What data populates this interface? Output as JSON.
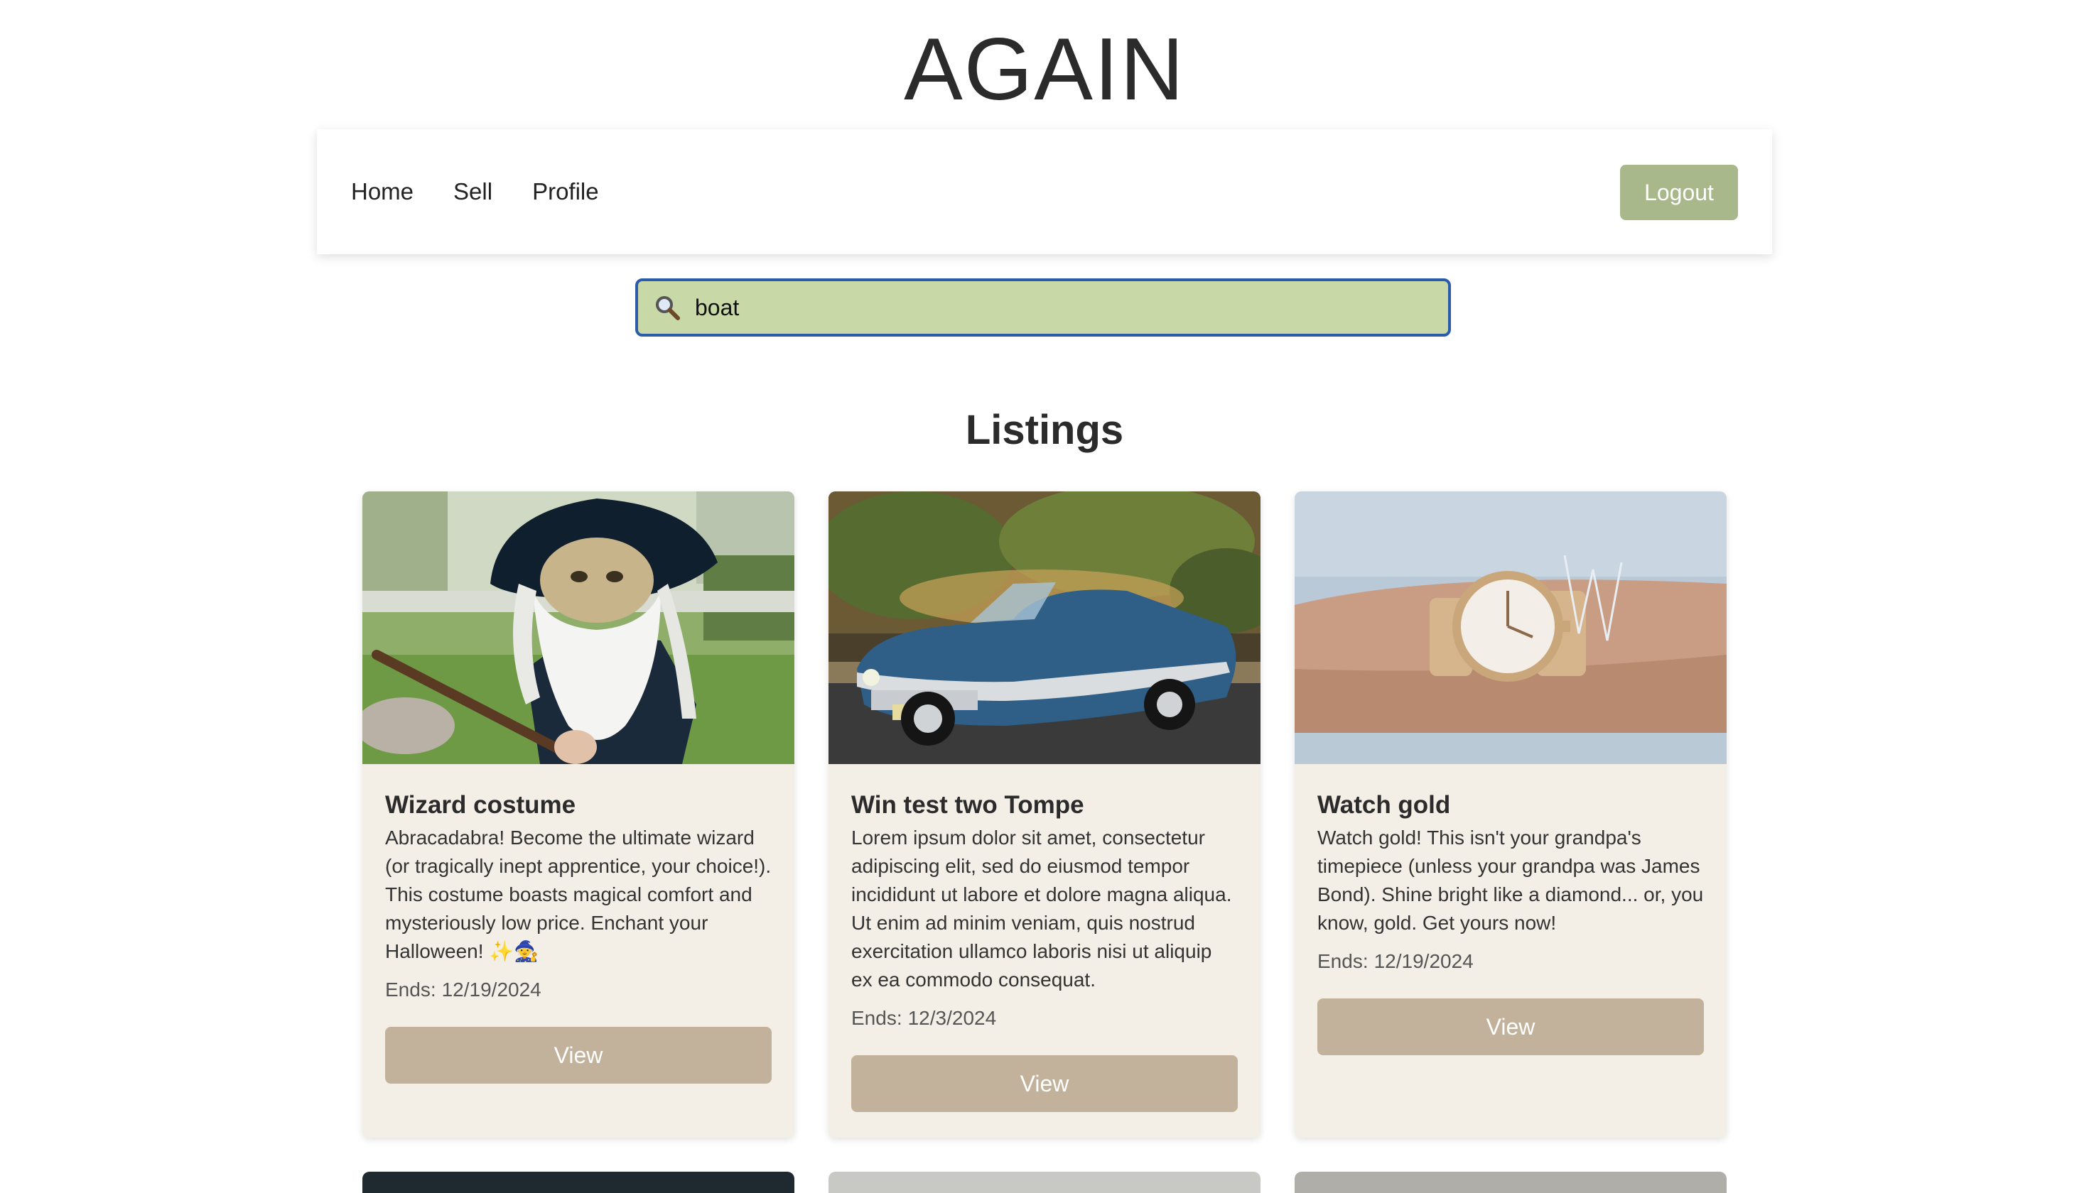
{
  "brand": {
    "title": "AGAIN"
  },
  "nav": {
    "links": [
      {
        "label": "Home"
      },
      {
        "label": "Sell"
      },
      {
        "label": "Profile"
      }
    ],
    "logout_label": "Logout"
  },
  "search": {
    "value": "boat",
    "icon": "magnifier-icon"
  },
  "listings": {
    "heading": "Listings",
    "ends_label": "Ends:",
    "view_label": "View",
    "cards": [
      {
        "title": "Wizard costume",
        "description": "Abracadabra! Become the ultimate wizard (or tragically inept apprentice, your choice!). This costume boasts magical comfort and mysteriously low price. Enchant your Halloween! ✨🧙",
        "ends": "12/19/2024",
        "image": "wizard-costume-photo"
      },
      {
        "title": "Win test two Tompe",
        "description": "Lorem ipsum dolor sit amet, consectetur adipiscing elit, sed do eiusmod tempor incididunt ut labore et dolore magna aliqua. Ut enim ad minim veniam, quis nostrud exercitation ullamco laboris nisi ut aliquip ex ea commodo consequat.",
        "ends": "12/3/2024",
        "image": "blue-vintage-convertible-photo"
      },
      {
        "title": "Watch gold",
        "description": "Watch gold! This isn't your grandpa's timepiece (unless your grandpa was James Bond). Shine bright like a diamond... or, you know, gold. Get yours now!",
        "ends": "12/19/2024",
        "image": "gold-wristwatch-photo"
      }
    ]
  },
  "colors": {
    "logout_bg": "#a8b88a",
    "search_bg": "#c8d8a6",
    "search_border": "#2a5cab",
    "card_bg": "#f3efe6",
    "view_button_bg": "#c2b29b"
  }
}
